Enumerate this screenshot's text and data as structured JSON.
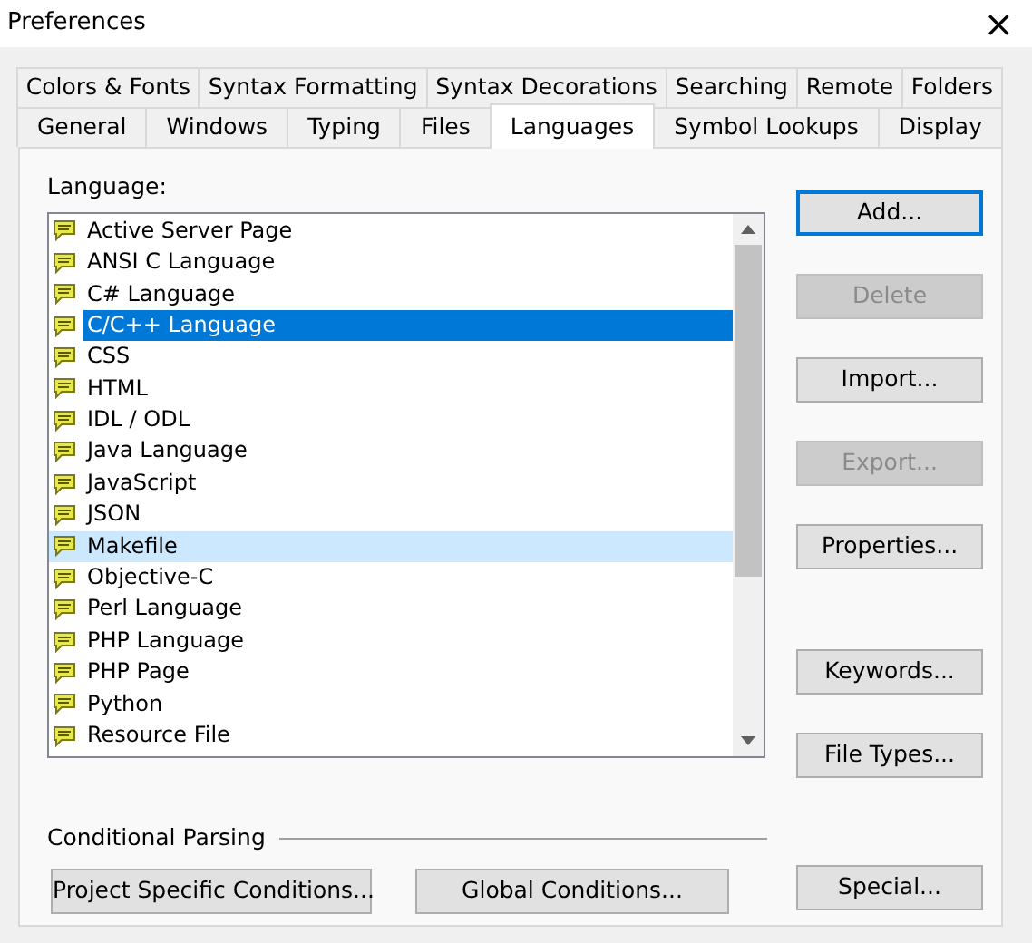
{
  "window": {
    "title": "Preferences",
    "close": "×"
  },
  "tab_rows": [
    [
      {
        "label": "Colors & Fonts",
        "selected": false
      },
      {
        "label": "Syntax Formatting",
        "selected": false
      },
      {
        "label": "Syntax Decorations",
        "selected": false
      },
      {
        "label": "Searching",
        "selected": false
      },
      {
        "label": "Remote",
        "selected": false
      },
      {
        "label": "Folders",
        "selected": false
      }
    ],
    [
      {
        "label": "General",
        "selected": false
      },
      {
        "label": "Windows",
        "selected": false
      },
      {
        "label": "Typing",
        "selected": false
      },
      {
        "label": "Files",
        "selected": false
      },
      {
        "label": "Languages",
        "selected": true
      },
      {
        "label": "Symbol Lookups",
        "selected": false
      },
      {
        "label": "Display",
        "selected": false
      }
    ]
  ],
  "language_label": "Language:",
  "languages": [
    {
      "name": "Active Server Page",
      "selected": false,
      "hovered": false
    },
    {
      "name": "ANSI C Language",
      "selected": false,
      "hovered": false
    },
    {
      "name": "C# Language",
      "selected": false,
      "hovered": false
    },
    {
      "name": "C/C++ Language",
      "selected": true,
      "hovered": false
    },
    {
      "name": "CSS",
      "selected": false,
      "hovered": false
    },
    {
      "name": "HTML",
      "selected": false,
      "hovered": false
    },
    {
      "name": "IDL / ODL",
      "selected": false,
      "hovered": false
    },
    {
      "name": "Java Language",
      "selected": false,
      "hovered": false
    },
    {
      "name": "JavaScript",
      "selected": false,
      "hovered": false
    },
    {
      "name": "JSON",
      "selected": false,
      "hovered": false
    },
    {
      "name": "Makefile",
      "selected": false,
      "hovered": true
    },
    {
      "name": "Objective-C",
      "selected": false,
      "hovered": false
    },
    {
      "name": "Perl Language",
      "selected": false,
      "hovered": false
    },
    {
      "name": "PHP Language",
      "selected": false,
      "hovered": false
    },
    {
      "name": "PHP Page",
      "selected": false,
      "hovered": false
    },
    {
      "name": "Python",
      "selected": false,
      "hovered": false
    },
    {
      "name": "Resource File",
      "selected": false,
      "hovered": false
    }
  ],
  "side_buttons": [
    {
      "label": "Add...",
      "disabled": false,
      "default": true
    },
    {
      "label": "Delete",
      "disabled": true,
      "default": false
    },
    {
      "label": "Import...",
      "disabled": false,
      "default": false
    },
    {
      "label": "Export...",
      "disabled": true,
      "default": false
    },
    {
      "label": "Properties...",
      "disabled": false,
      "default": false
    },
    {
      "label": "Keywords...",
      "disabled": false,
      "default": false
    },
    {
      "label": "File Types...",
      "disabled": false,
      "default": false
    }
  ],
  "conditional_parsing": {
    "title": "Conditional Parsing",
    "buttons": [
      "Project Specific Conditions...",
      "Global Conditions..."
    ]
  },
  "special_button": "Special..."
}
